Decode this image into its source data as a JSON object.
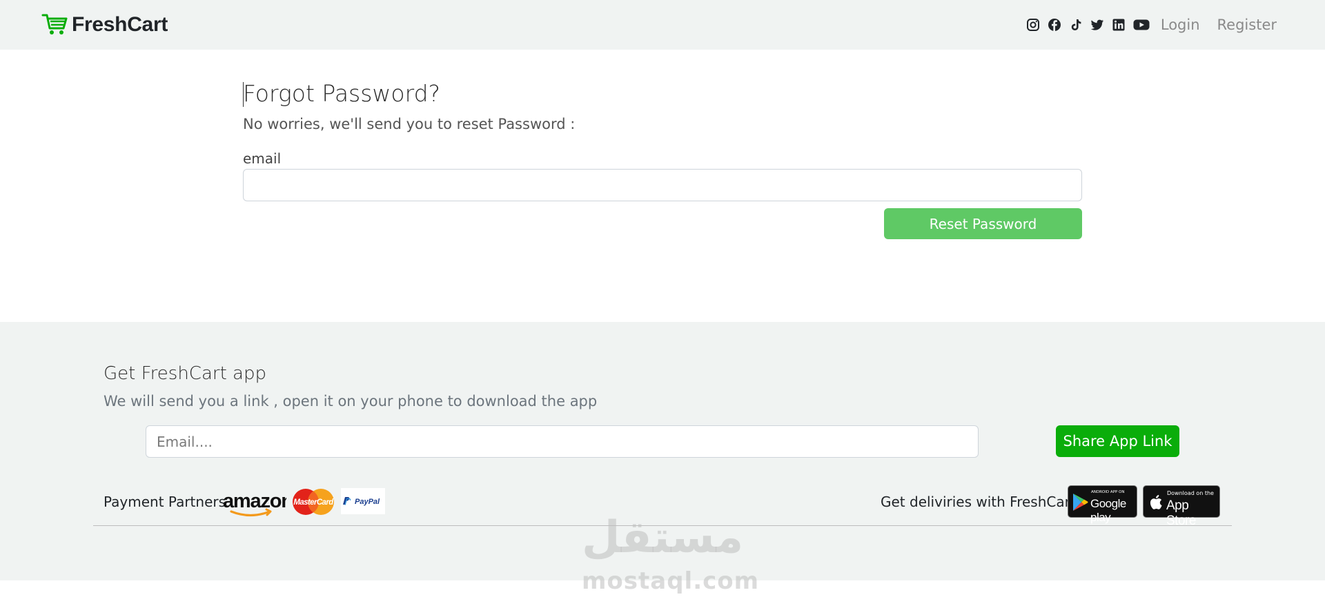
{
  "navbar": {
    "brand": "FreshCart",
    "social_icons": [
      "instagram-icon",
      "facebook-icon",
      "tiktok-icon",
      "twitter-icon",
      "linkedin-icon",
      "youtube-icon"
    ],
    "login": "Login",
    "register": "Register"
  },
  "form": {
    "title": "Forgot Password?",
    "subtitle": "No worries, we'll send you to reset Password :",
    "email_label": "email",
    "email_value": "",
    "submit": "Reset Password"
  },
  "footer": {
    "app_title": "Get FreshCart app",
    "app_subtitle": "We will send you a link , open it on your phone to download the app",
    "email_placeholder": "Email....",
    "share_button": "Share App Link",
    "partners_label": "Payment Partners",
    "partners": [
      "amazon",
      "MasterCard",
      "PayPal"
    ],
    "deliveries_label": "Get deliviries with FreshCart",
    "google_play": {
      "small": "ANDROID APP ON",
      "big": "Google play"
    },
    "app_store": {
      "small": "Download on the",
      "big": "App Store"
    }
  },
  "watermark": {
    "arabic": "مستقل",
    "latin": "mostaql.com"
  },
  "colors": {
    "brand_green": "#0aad0a",
    "reset_button_green": "#5fc965",
    "navbar_bg": "#f0f3f2",
    "footer_bg": "#f0f3f2"
  }
}
